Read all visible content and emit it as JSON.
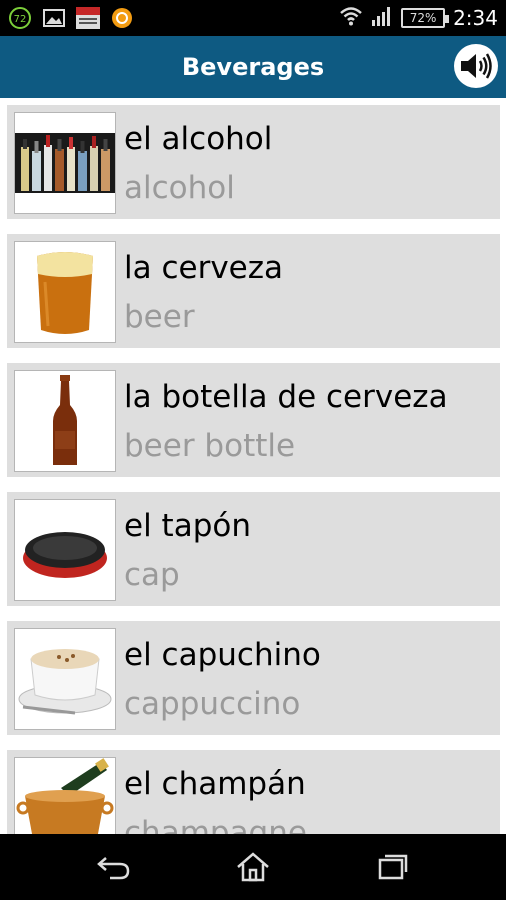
{
  "status_bar": {
    "time": "2:34",
    "battery": "72%",
    "notification_badge": "72",
    "icons": [
      "notification-72-icon",
      "image-icon",
      "news-app-icon",
      "orange-app-icon",
      "wifi-icon",
      "signal-icon",
      "battery-icon"
    ]
  },
  "header": {
    "title": "Beverages",
    "sound_icon": "speaker-icon"
  },
  "items": [
    {
      "word": "el alcohol",
      "translation": "alcohol",
      "image": "liquor-bottles-image"
    },
    {
      "word": "la cerveza",
      "translation": "beer",
      "image": "beer-glass-image"
    },
    {
      "word": "la botella de cerveza",
      "translation": "beer bottle",
      "image": "beer-bottle-image"
    },
    {
      "word": "el tapón",
      "translation": "cap",
      "image": "bottle-cap-image"
    },
    {
      "word": "el capuchino",
      "translation": "cappuccino",
      "image": "cappuccino-cup-image"
    },
    {
      "word": "el champán",
      "translation": "champagne",
      "image": "champagne-bucket-image"
    }
  ],
  "nav_bar": {
    "icons": [
      "back-icon",
      "home-icon",
      "recent-apps-icon"
    ]
  },
  "colors": {
    "header": "#0e5a82",
    "item_bg": "#dedede",
    "translation_text": "#9a9a9a"
  }
}
